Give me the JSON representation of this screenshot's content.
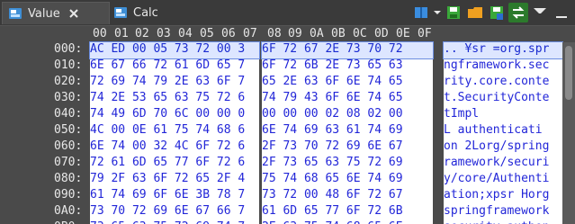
{
  "tabs": [
    {
      "label": "Value",
      "active": true
    },
    {
      "label": "Calc",
      "active": false
    }
  ],
  "toolbar": {
    "icons": [
      "book-icon",
      "save-green-icon",
      "folder-icon",
      "save-blue-icon",
      "swap-icon",
      "filter-icon"
    ]
  },
  "hex": {
    "columns": [
      "00",
      "01",
      "02",
      "03",
      "04",
      "05",
      "06",
      "07",
      "08",
      "09",
      "0A",
      "0B",
      "0C",
      "0D",
      "0E",
      "0F"
    ],
    "rows": [
      {
        "offset": "000:",
        "left": "AC ED 00 05 73 72 00 3",
        "right": "6F 72 67 2E 73 70 72",
        "ascii": ".. ¥sr =org.spr"
      },
      {
        "offset": "010:",
        "left": "6E 67 66 72 61 6D 65 7",
        "right": "6F 72 6B 2E 73 65 63",
        "ascii": "ngframework.sec"
      },
      {
        "offset": "020:",
        "left": "72 69 74 79 2E 63 6F 7",
        "right": "65 2E 63 6F 6E 74 65",
        "ascii": "rity.core.conte"
      },
      {
        "offset": "030:",
        "left": "74 2E 53 65 63 75 72 6",
        "right": "74 79 43 6F 6E 74 65",
        "ascii": "t.SecurityConte"
      },
      {
        "offset": "040:",
        "left": "74 49 6D 70 6C 00 00 0",
        "right": "00 00 00 02 08 02 00",
        "ascii": "tImpl      "
      },
      {
        "offset": "050:",
        "left": "4C 00 0E 61 75 74 68 6",
        "right": "6E 74 69 63 61 74 69",
        "ascii": "L authenticati"
      },
      {
        "offset": "060:",
        "left": "6E 74 00 32 4C 6F 72 6",
        "right": "2F 73 70 72 69 6E 67",
        "ascii": "on 2Lorg/spring"
      },
      {
        "offset": "070:",
        "left": "72 61 6D 65 77 6F 72 6",
        "right": "2F 73 65 63 75 72 69",
        "ascii": "ramework/securi"
      },
      {
        "offset": "080:",
        "left": "79 2F 63 6F 72 65 2F 4",
        "right": "75 74 68 65 6E 74 69",
        "ascii": "y/core/Authenti"
      },
      {
        "offset": "090:",
        "left": "61 74 69 6F 6E 3B 78 7",
        "right": "73 72 00 48 6F 72 67",
        "ascii": "ation;xpsr Horg"
      },
      {
        "offset": "0A0:",
        "left": "73 70 72 69 6E 67 66 7",
        "right": "61 6D 65 77 6F 72 6B",
        "ascii": "springframework"
      },
      {
        "offset": "0B0:",
        "left": "73 65 63 75 72 69 74 7",
        "right": "2E 63 75 74 68 65 6E",
        "ascii": "security.authen"
      }
    ]
  }
}
